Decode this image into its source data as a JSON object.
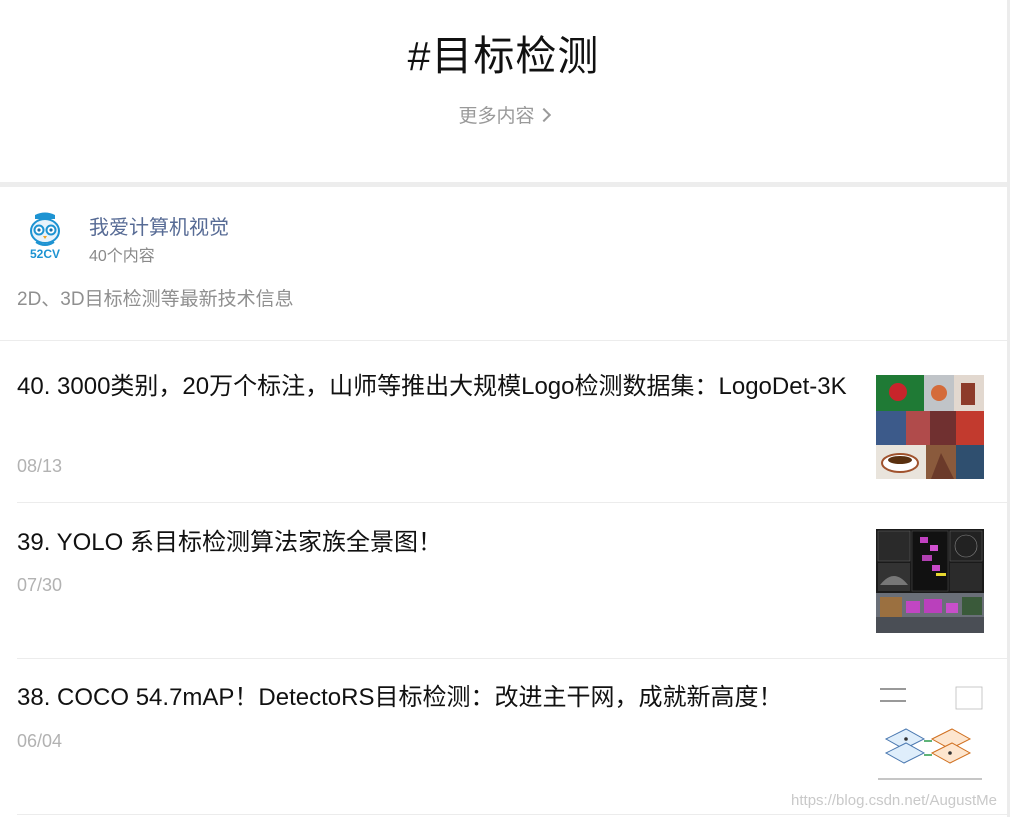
{
  "header": {
    "title": "#目标检测",
    "more_label": "更多内容"
  },
  "account": {
    "avatar_text": "52CV",
    "name": "我爱计算机视觉",
    "count": "40个内容",
    "description": "2D、3D目标检测等最新技术信息"
  },
  "articles": [
    {
      "title": "40. 3000类别，20万个标注，山师等推出大规模Logo检测数据集：LogoDet-3K",
      "date": "08/13"
    },
    {
      "title": "39. YOLO 系目标检测算法家族全景图！",
      "date": "07/30"
    },
    {
      "title": "38. COCO 54.7mAP！DetectoRS目标检测：改进主干网，成就新高度！",
      "date": "06/04"
    }
  ],
  "watermark": "https://blog.csdn.net/AugustMe",
  "colors": {
    "link": "#576b95",
    "muted": "#9a9a9a",
    "date": "#b2b2b2",
    "divider": "#ededed"
  }
}
